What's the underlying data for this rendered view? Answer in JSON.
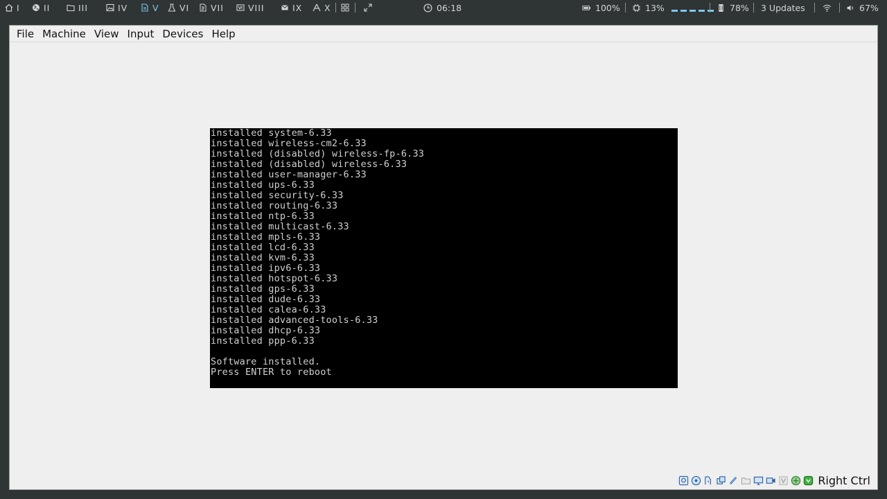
{
  "topbar": {
    "workspaces": [
      {
        "label": "I",
        "icon": "home-icon"
      },
      {
        "label": "II",
        "icon": "globe-icon"
      },
      {
        "label": "III",
        "icon": "folder-icon"
      },
      {
        "label": "IV",
        "icon": "image-icon"
      },
      {
        "label": "V",
        "icon": "document-icon",
        "active": true
      },
      {
        "label": "VI",
        "icon": "flask-icon"
      },
      {
        "label": "VII",
        "icon": "file-text-icon"
      },
      {
        "label": "VIII",
        "icon": "virtualbox-icon"
      },
      {
        "label": "IX",
        "icon": "mail-icon"
      },
      {
        "label": "X",
        "icon": "inkscape-icon"
      }
    ],
    "clock": "06:18",
    "battery": "100%",
    "cpu": "13%",
    "memory": "78%",
    "updates": "3 Updates",
    "volume": "67%",
    "accent_color": "#7ec8f0"
  },
  "vm": {
    "menu": [
      "File",
      "Machine",
      "View",
      "Input",
      "Devices",
      "Help"
    ],
    "console_lines": [
      "installed system-6.33",
      "installed wireless-cm2-6.33",
      "installed (disabled) wireless-fp-6.33",
      "installed (disabled) wireless-6.33",
      "installed user-manager-6.33",
      "installed ups-6.33",
      "installed security-6.33",
      "installed routing-6.33",
      "installed ntp-6.33",
      "installed multicast-6.33",
      "installed mpls-6.33",
      "installed lcd-6.33",
      "installed kvm-6.33",
      "installed ipv6-6.33",
      "installed hotspot-6.33",
      "installed gps-6.33",
      "installed dude-6.33",
      "installed calea-6.33",
      "installed advanced-tools-6.33",
      "installed dhcp-6.33",
      "installed ppp-6.33",
      "",
      "Software installed.",
      "Press ENTER to reboot"
    ],
    "status_icons": [
      "hard-disk-icon",
      "optical-drive-icon",
      "audio-icon",
      "network-icon",
      "usb-icon",
      "shared-folder-icon",
      "display-icon",
      "recording-icon",
      "virtualization-icon",
      "mouse-integration-icon",
      "keyboard-icon"
    ],
    "host_key": "Right Ctrl"
  }
}
